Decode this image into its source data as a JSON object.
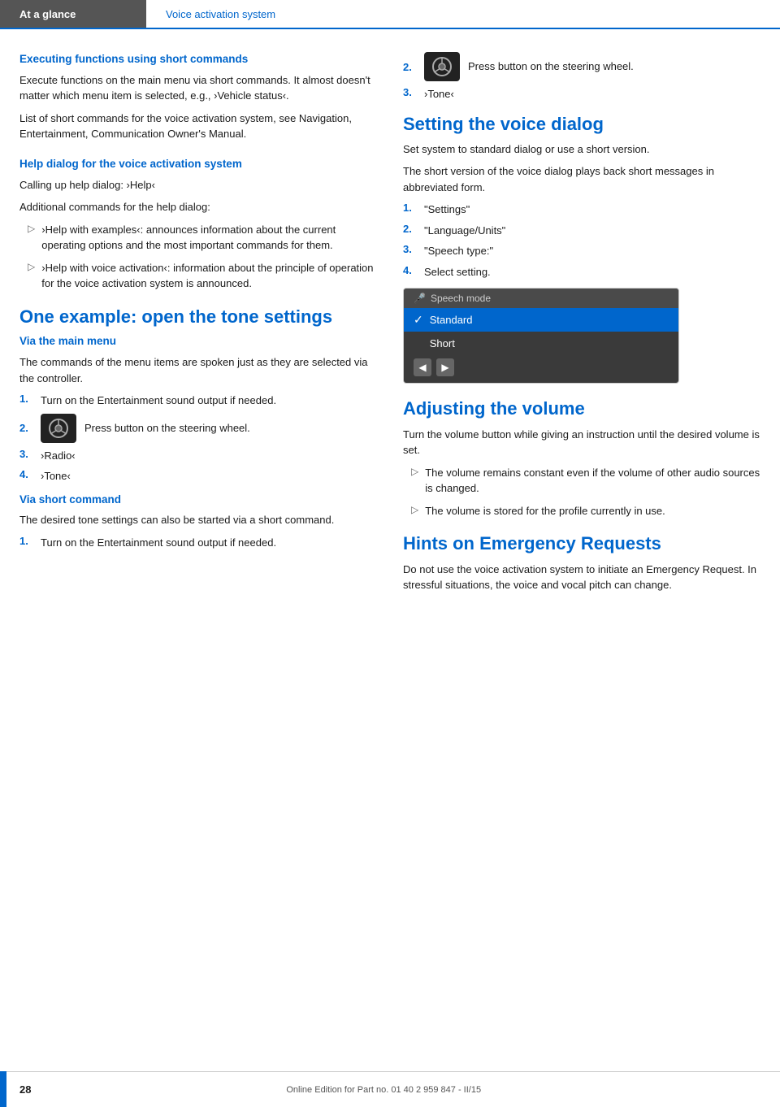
{
  "header": {
    "left_label": "At a glance",
    "right_label": "Voice activation system"
  },
  "left_col": {
    "section1": {
      "title": "Executing functions using short commands",
      "para1": "Execute functions on the main menu via short commands. It almost doesn't matter which menu item is selected, e.g., ›Vehicle status‹.",
      "para2": "List of short commands for the voice activation system, see Navigation, Entertainment, Communication Owner's Manual."
    },
    "section2": {
      "title": "Help dialog for the voice activation system",
      "para1": "Calling up help dialog: ›Help‹",
      "para2": "Additional commands for the help dialog:",
      "bullets": [
        "›Help with examples‹: announces information about the current operating options and the most important commands for them.",
        "›Help with voice activation‹: information about the principle of operation for the voice activation system is announced."
      ]
    },
    "section3": {
      "title": "One example: open the tone settings",
      "subtitle1": "Via the main menu",
      "via_main_para": "The commands of the menu items are spoken just as they are selected via the controller.",
      "via_main_steps": [
        {
          "num": "1.",
          "text": "Turn on the Entertainment sound output if needed."
        },
        {
          "num": "2.",
          "text": "Press button on the steering wheel."
        },
        {
          "num": "3.",
          "text": "›Radio‹"
        },
        {
          "num": "4.",
          "text": "›Tone‹"
        }
      ],
      "subtitle2": "Via short command",
      "via_short_para": "The desired tone settings can also be started via a short command.",
      "via_short_steps": [
        {
          "num": "1.",
          "text": "Turn on the Entertainment sound output if needed."
        }
      ]
    }
  },
  "right_col": {
    "step2_right": {
      "num": "2.",
      "text": "Press button on the steering wheel."
    },
    "step3_right": {
      "num": "3.",
      "text": "›Tone‹"
    },
    "section_voice_dialog": {
      "title": "Setting the voice dialog",
      "para1": "Set system to standard dialog or use a short version.",
      "para2": "The short version of the voice dialog plays back short messages in abbreviated form.",
      "steps": [
        {
          "num": "1.",
          "text": "\"Settings\""
        },
        {
          "num": "2.",
          "text": "\"Language/Units\""
        },
        {
          "num": "3.",
          "text": "\"Speech type:\""
        },
        {
          "num": "4.",
          "text": "Select setting."
        }
      ],
      "speech_mode_box": {
        "title": "Speech mode",
        "items": [
          {
            "label": "Standard",
            "selected": true
          },
          {
            "label": "Short",
            "selected": false
          }
        ]
      }
    },
    "section_volume": {
      "title": "Adjusting the volume",
      "para": "Turn the volume button while giving an instruction until the desired volume is set.",
      "bullets": [
        "The volume remains constant even if the volume of other audio sources is changed.",
        "The volume is stored for the profile currently in use."
      ]
    },
    "section_emergency": {
      "title": "Hints on Emergency Requests",
      "para": "Do not use the voice activation system to initiate an Emergency Request. In stressful situations, the voice and vocal pitch can change."
    }
  },
  "footer": {
    "page_num": "28",
    "center_text": "Online Edition for Part no. 01 40 2 959 847 - II/15"
  },
  "icons": {
    "steering_wheel": "steering-wheel-icon",
    "bullet_arrow": "▷",
    "check_mark": "✓",
    "speech_icon": "🎤"
  }
}
